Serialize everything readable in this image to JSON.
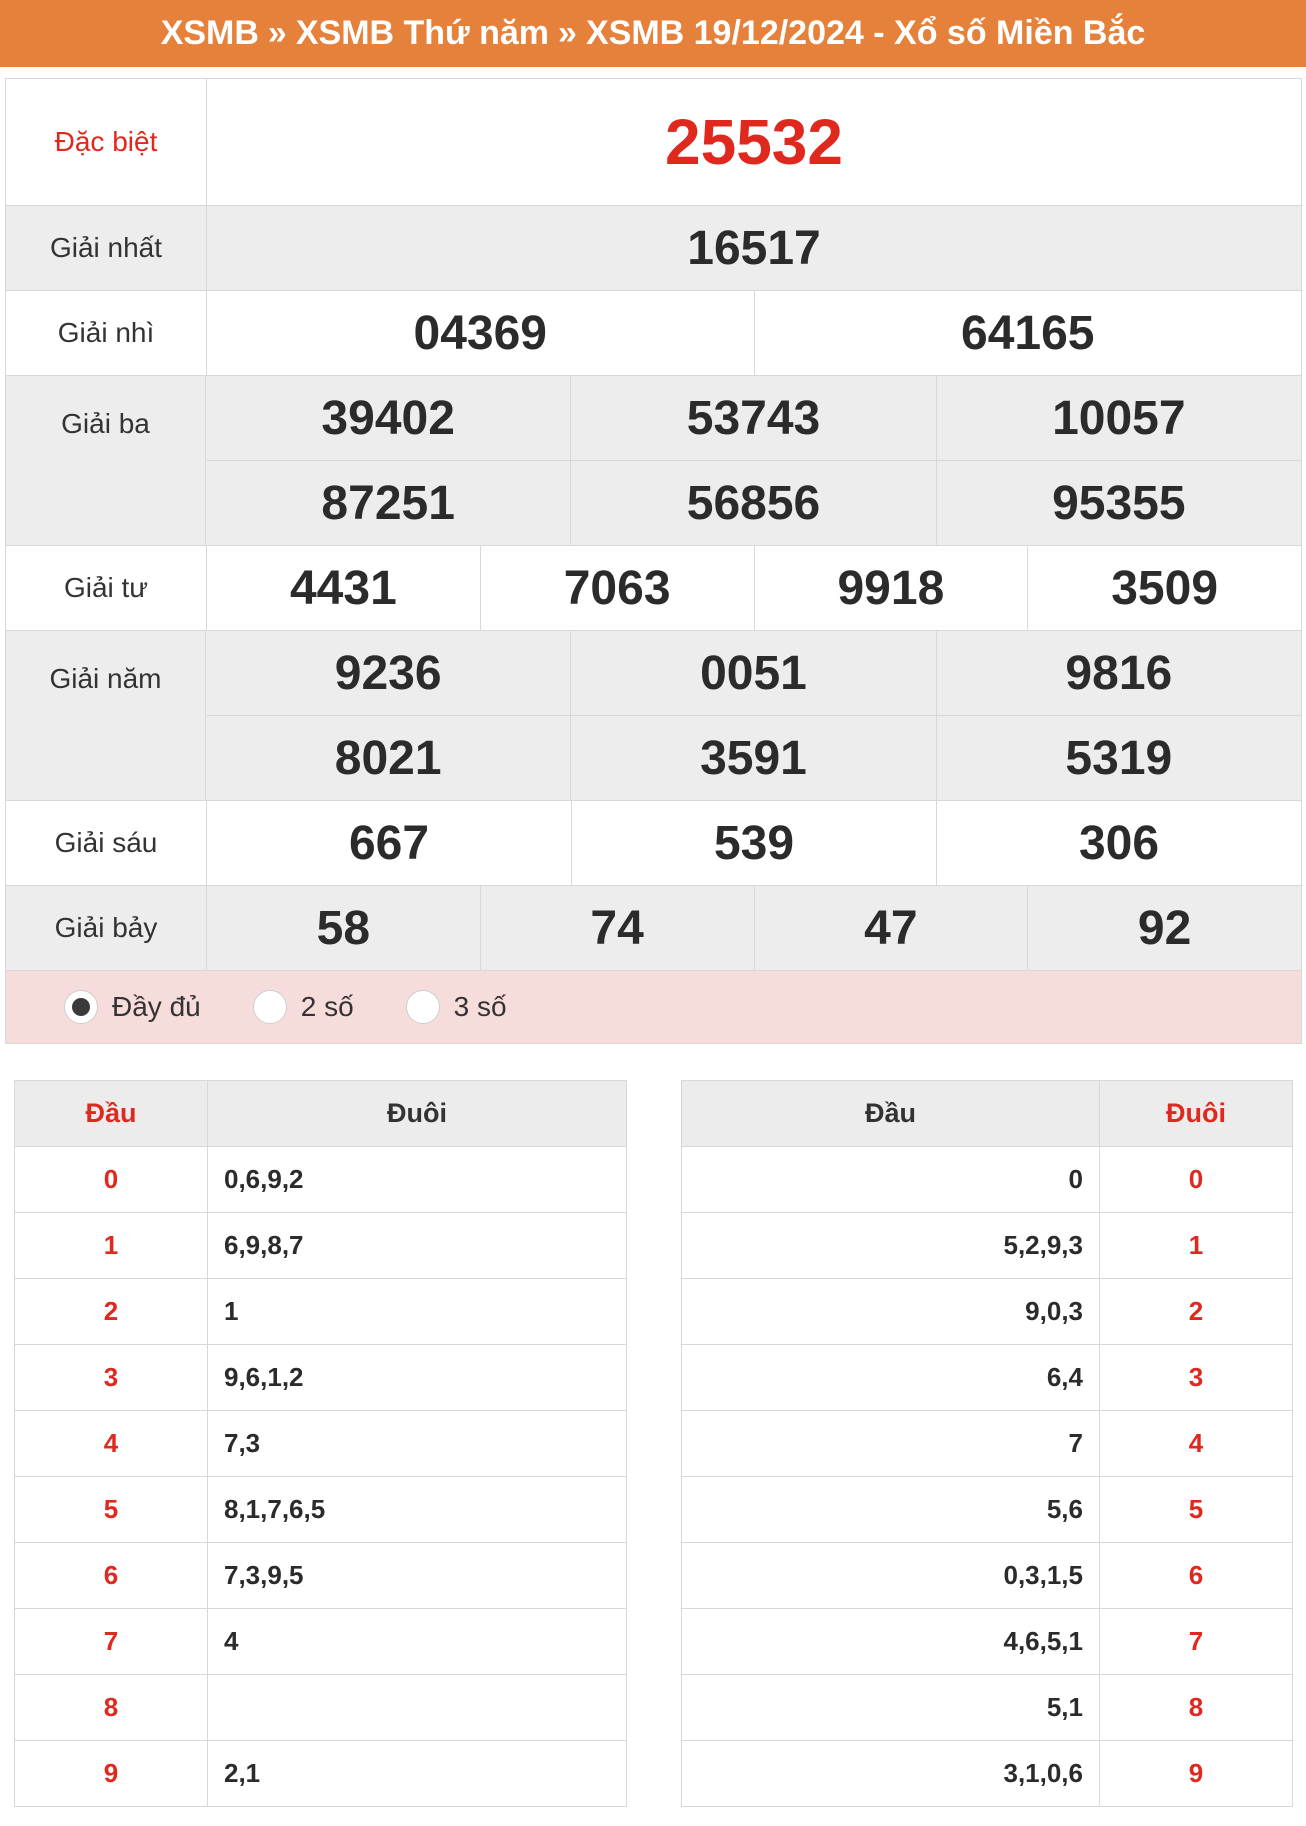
{
  "header": {
    "crumb1": "XSMB",
    "crumb2": "XSMB Thứ năm",
    "crumb3": "XSMB 19/12/2024 - Xổ số Miền Bắc",
    "separator": "»"
  },
  "prizes": [
    {
      "label": "Đặc biệt",
      "rows": [
        [
          "25532"
        ]
      ]
    },
    {
      "label": "Giải nhất",
      "rows": [
        [
          "16517"
        ]
      ]
    },
    {
      "label": "Giải nhì",
      "rows": [
        [
          "04369",
          "64165"
        ]
      ]
    },
    {
      "label": "Giải ba",
      "rows": [
        [
          "39402",
          "53743",
          "10057"
        ],
        [
          "87251",
          "56856",
          "95355"
        ]
      ]
    },
    {
      "label": "Giải tư",
      "rows": [
        [
          "4431",
          "7063",
          "9918",
          "3509"
        ]
      ]
    },
    {
      "label": "Giải năm",
      "rows": [
        [
          "9236",
          "0051",
          "9816"
        ],
        [
          "8021",
          "3591",
          "5319"
        ]
      ]
    },
    {
      "label": "Giải sáu",
      "rows": [
        [
          "667",
          "539",
          "306"
        ]
      ]
    },
    {
      "label": "Giải bảy",
      "rows": [
        [
          "58",
          "74",
          "47",
          "92"
        ]
      ]
    }
  ],
  "options": {
    "selected": "full",
    "full": "Đầy đủ",
    "two": "2 số",
    "three": "3 số"
  },
  "loto_left": {
    "head": "Đầu",
    "tail": "Đuôi",
    "rows": [
      {
        "head": "0",
        "tail": "0,6,9,2"
      },
      {
        "head": "1",
        "tail": "6,9,8,7"
      },
      {
        "head": "2",
        "tail": "1"
      },
      {
        "head": "3",
        "tail": "9,6,1,2"
      },
      {
        "head": "4",
        "tail": "7,3"
      },
      {
        "head": "5",
        "tail": "8,1,7,6,5"
      },
      {
        "head": "6",
        "tail": "7,3,9,5"
      },
      {
        "head": "7",
        "tail": "4"
      },
      {
        "head": "8",
        "tail": ""
      },
      {
        "head": "9",
        "tail": "2,1"
      }
    ]
  },
  "loto_right": {
    "head": "Đầu",
    "tail": "Đuôi",
    "rows": [
      {
        "head": "0",
        "tail": "0"
      },
      {
        "head": "5,2,9,3",
        "tail": "1"
      },
      {
        "head": "9,0,3",
        "tail": "2"
      },
      {
        "head": "6,4",
        "tail": "3"
      },
      {
        "head": "7",
        "tail": "4"
      },
      {
        "head": "5,6",
        "tail": "5"
      },
      {
        "head": "0,3,1,5",
        "tail": "6"
      },
      {
        "head": "4,6,5,1",
        "tail": "7"
      },
      {
        "head": "5,1",
        "tail": "8"
      },
      {
        "head": "3,1,0,6",
        "tail": "9"
      }
    ]
  },
  "colors": {
    "header_bg": "#e5813a",
    "accent_red": "#e0291e",
    "options_bg": "#f7dcdc",
    "row_gray": "#ededed"
  }
}
